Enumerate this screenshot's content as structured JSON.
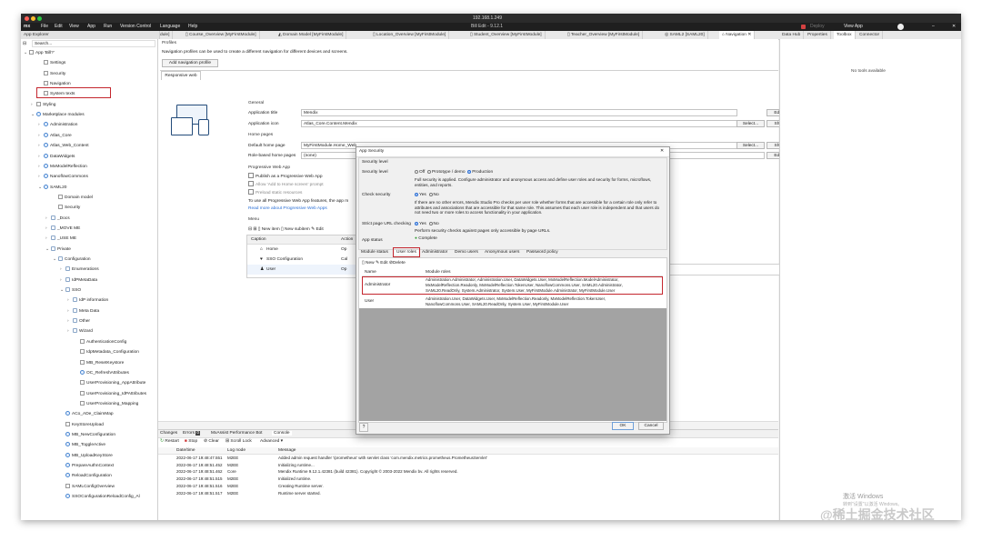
{
  "titlebar": {
    "title": "192.168.1.249",
    "subtitle": "Bill Edit - 9.12.1"
  },
  "menubar": {
    "logo": "mx",
    "items": [
      "File",
      "Edit",
      "View",
      "App",
      "Run",
      "Version Control",
      "Language",
      "Help"
    ],
    "right_items": [
      "Deploy",
      "View App"
    ]
  },
  "doc_tabs": [
    {
      "label": "dule]"
    },
    {
      "label": "Course_Overview [MyFirstModule]"
    },
    {
      "label": "Domain Model [MyFirstModule]"
    },
    {
      "label": "Location_Overview [MyFirstModule]"
    },
    {
      "label": "Student_Overview [MyFirstModule]"
    },
    {
      "label": "Teacher_Overview [MyFirstModule]"
    },
    {
      "label": "SAML2 [SAML20]"
    },
    {
      "label": "Navigation"
    }
  ],
  "right_tabs": [
    "Data Hub",
    "Properties",
    "Toolbox",
    "Connector"
  ],
  "right_panel": {
    "empty_text": "No tools available"
  },
  "explorer": {
    "title": "App Explorer",
    "search_placeholder": "Search...",
    "rows": [
      {
        "label": "App 'Bill?'",
        "indent": 0,
        "tw": "⌄",
        "icon": "app-icon"
      },
      {
        "label": "Settings",
        "indent": 2,
        "tw": "",
        "icon": "gear-icon"
      },
      {
        "label": "Security",
        "indent": 2,
        "tw": "",
        "icon": "key-icon"
      },
      {
        "label": "Navigation",
        "indent": 2,
        "tw": "",
        "icon": "navigation-icon"
      },
      {
        "label": "System texts",
        "indent": 2,
        "tw": "",
        "icon": "texts-icon"
      },
      {
        "label": "Styling",
        "indent": 1,
        "tw": "›",
        "icon": "styling-icon"
      },
      {
        "label": "Marketplace modules",
        "indent": 1,
        "tw": "⌄",
        "icon": "module-icon"
      },
      {
        "label": "Administration",
        "indent": 2,
        "tw": "›",
        "icon": "module-icon"
      },
      {
        "label": "Atlas_Core",
        "indent": 2,
        "tw": "›",
        "icon": "module-icon"
      },
      {
        "label": "Atlas_Web_Content",
        "indent": 2,
        "tw": "›",
        "icon": "module-icon"
      },
      {
        "label": "DataWidgets",
        "indent": 2,
        "tw": "›",
        "icon": "module-icon"
      },
      {
        "label": "MxModelReflection",
        "indent": 2,
        "tw": "›",
        "icon": "module-icon"
      },
      {
        "label": "NanoflowCommons",
        "indent": 2,
        "tw": "›",
        "icon": "module-icon"
      },
      {
        "label": "SAML20",
        "indent": 2,
        "tw": "⌄",
        "icon": "module-icon"
      },
      {
        "label": "Domain model",
        "indent": 4,
        "tw": "",
        "icon": "domain-model-icon"
      },
      {
        "label": "Security",
        "indent": 4,
        "tw": "",
        "icon": "key-icon"
      },
      {
        "label": "_Docs",
        "indent": 3,
        "tw": "›",
        "icon": "folder-icon"
      },
      {
        "label": "_MOVE ME",
        "indent": 3,
        "tw": "›",
        "icon": "folder-icon"
      },
      {
        "label": "_USE ME",
        "indent": 3,
        "tw": "›",
        "icon": "folder-icon"
      },
      {
        "label": "Private",
        "indent": 3,
        "tw": "⌄",
        "icon": "folder-icon"
      },
      {
        "label": "Configuration",
        "indent": 4,
        "tw": "⌄",
        "icon": "folder-icon"
      },
      {
        "label": "Enumerations",
        "indent": 5,
        "tw": "›",
        "icon": "folder-icon"
      },
      {
        "label": "IdPMetaData",
        "indent": 5,
        "tw": "›",
        "icon": "folder-icon"
      },
      {
        "label": "SSO",
        "indent": 5,
        "tw": "⌄",
        "icon": "folder-icon"
      },
      {
        "label": "IdP information",
        "indent": 6,
        "tw": "›",
        "icon": "folder-icon"
      },
      {
        "label": "Meta Data",
        "indent": 6,
        "tw": "›",
        "icon": "folder-icon"
      },
      {
        "label": "Other",
        "indent": 6,
        "tw": "›",
        "icon": "folder-icon"
      },
      {
        "label": "Wizard",
        "indent": 6,
        "tw": "›",
        "icon": "folder-icon"
      },
      {
        "label": "AuthenticationConfig",
        "indent": 7,
        "tw": "",
        "icon": "page-icon"
      },
      {
        "label": "IdpMetadata_Configuration",
        "indent": 7,
        "tw": "",
        "icon": "page-icon"
      },
      {
        "label": "MB_ResetKeystore",
        "indent": 7,
        "tw": "",
        "icon": "page-icon"
      },
      {
        "label": "OC_RefreshAttributes",
        "indent": 7,
        "tw": "",
        "icon": "microflow-icon"
      },
      {
        "label": "UserProvisioning_AppAttribute",
        "indent": 7,
        "tw": "",
        "icon": "page-icon"
      },
      {
        "label": "UserProvisioning_IdPAttributes",
        "indent": 7,
        "tw": "",
        "icon": "page-icon"
      },
      {
        "label": "UserProvisioning_Mapping",
        "indent": 7,
        "tw": "",
        "icon": "page-icon"
      },
      {
        "label": "ACo_ADe_ClaimMap",
        "indent": 5,
        "tw": "",
        "icon": "microflow-icon"
      },
      {
        "label": "KeyStoreUpload",
        "indent": 5,
        "tw": "",
        "icon": "page-icon"
      },
      {
        "label": "MB_NewConfiguration",
        "indent": 5,
        "tw": "",
        "icon": "microflow-icon"
      },
      {
        "label": "MB_ToggleActive",
        "indent": 5,
        "tw": "",
        "icon": "microflow-icon"
      },
      {
        "label": "MB_UploadKeyStore",
        "indent": 5,
        "tw": "",
        "icon": "microflow-icon"
      },
      {
        "label": "PrepareAuthnContext",
        "indent": 5,
        "tw": "",
        "icon": "microflow-icon"
      },
      {
        "label": "ReloadConfiguration",
        "indent": 5,
        "tw": "",
        "icon": "microflow-icon"
      },
      {
        "label": "SAMLConfigOverview",
        "indent": 5,
        "tw": "",
        "icon": "page-icon"
      },
      {
        "label": "SSOConfigurationReloadConfig_Al",
        "indent": 5,
        "tw": "",
        "icon": "microflow-icon"
      }
    ]
  },
  "profiles": {
    "title": "Profiles",
    "description": "Navigation profiles can be used to create a different navigation for different devices and screens.",
    "add_button": "Add navigation profile",
    "tab": "Responsive web"
  },
  "general": {
    "heading": "General",
    "app_title_label": "Application title",
    "app_title_value": "Mendix",
    "app_icon_label": "Application icon",
    "app_icon_value": "Atlas_Core.Content.Mendix",
    "edit": "Edit...",
    "select": "Select...",
    "show": "Show"
  },
  "home_pages": {
    "heading": "Home pages",
    "default_label": "Default home page",
    "default_value": "MyFirstModule.Home_Web",
    "role_label": "Role-based home pages",
    "role_value": "(none)"
  },
  "pwa": {
    "heading": "Progressive Web App",
    "publish": "Publish as a Progressive Web App",
    "allow": "Allow 'Add to Home screen' prompt",
    "preload": "Preload static resources",
    "info": "To use all Progressive Web App features, the app m",
    "link": "Read more about Progressive Web Apps"
  },
  "menu": {
    "heading": "Menu",
    "new_item": "New item",
    "new_subitem": "New subitem",
    "edit": "Edit",
    "col_caption": "Caption",
    "col_action": "Action",
    "rows": [
      {
        "caption": "Home",
        "icon": "home-icon",
        "action": "Op"
      },
      {
        "caption": "SSO Configuration",
        "icon": "heart-icon",
        "action": "Cal"
      },
      {
        "caption": "User",
        "icon": "user-icon",
        "action": "Op"
      }
    ]
  },
  "dialog": {
    "title": "App Security",
    "group": "Security level",
    "security_level_label": "Security level",
    "levels": [
      "Off",
      "Prototype / demo",
      "Production"
    ],
    "level_info": "Full security is applied. Configure administrator and anonymous access and define user roles and security for forms, microflows, entities, and reports.",
    "check_security_label": "Check security",
    "yes": "Yes",
    "no": "No",
    "check_info": "If there are no other errors, Mendix Studio Pro checks per user role whether forms that are accessible for a certain role only refer to attributes and associations that are accessible for that same role. This assumes that each user role is independent and that users do not need two or more roles to access functionality in your application.",
    "strict_label": "Strict page URL checking",
    "strict_info": "Perform security checks against pages only accessible by page URLs.",
    "app_status_label": "App status",
    "app_status_value": "Complete",
    "tabs": [
      "Module status",
      "User roles",
      "Administrator",
      "Demo users",
      "Anonymous users",
      "Password policy"
    ],
    "new": "New",
    "edit": "Edit",
    "delete": "Delete",
    "col_name": "Name",
    "col_module_roles": "Module roles",
    "roles": [
      {
        "name": "Administrator",
        "modules": [
          "Administration.Administrator, Administration.User, DataWidgets.User, MxModelReflection.ModelAdministrator,",
          "MxModelReflection.Readonly, MxModelReflection.TokenUser, NanoflowCommons.User, SAML20.Administrator,",
          "SAML20.ReadOnly, System.Administrator, System.User, MyFirstModule.Administrator, MyFirstModule.User"
        ]
      },
      {
        "name": "User",
        "modules": [
          "Administration.User, DataWidgets.User, MxModelReflection.Readonly, MxModelReflection.TokenUser,",
          "NanoflowCommons.User, SAML20.ReadOnly, System.User, MyFirstModule.User"
        ]
      }
    ],
    "ok": "OK",
    "cancel": "Cancel"
  },
  "bottom": {
    "tabs": [
      "Changes",
      "Errors",
      "MxAssist Performance Bot",
      "Console"
    ],
    "error_count": "0",
    "toolbar": [
      "Restart",
      "Stop",
      "Clear",
      "Scroll Lock",
      "Advanced"
    ],
    "columns": [
      "Date/time",
      "Log node",
      "Message"
    ],
    "rows": [
      {
        "time": "2022-06-17 19:48:47.551",
        "node": "M2EE",
        "message": "Added admin request handler '/prometheus' with servlet class 'com.mendix.metrics.prometheus.PrometheusServlet'"
      },
      {
        "time": "2022-06-17 19:48:51.452",
        "node": "M2EE",
        "message": "Initializing runtime..."
      },
      {
        "time": "2022-06-17 19:48:51.462",
        "node": "Core",
        "message": "Mendix Runtime 9.12.1.42381 (build 42381). Copyright © 2003-2022 Mendix bv. All rights reserved."
      },
      {
        "time": "2022-06-17 19:48:51.515",
        "node": "M2EE",
        "message": "Initialized runtime."
      },
      {
        "time": "2022-06-17 19:48:51.516",
        "node": "M2EE",
        "message": "Creating Runtime server."
      },
      {
        "time": "2022-06-17 19:48:51.517",
        "node": "M2EE",
        "message": "Runtime server started."
      }
    ]
  },
  "watermark": {
    "activate": "激活 Windows",
    "activate_sub": "转到\"设置\"以激活 Windows。",
    "site": "@稀土掘金技术社区"
  },
  "colors": {
    "highlight": "#c4262e",
    "accent": "#2a6fd6",
    "selected_row": "#cde0f7",
    "grid_gray": "#a3a3a3"
  }
}
